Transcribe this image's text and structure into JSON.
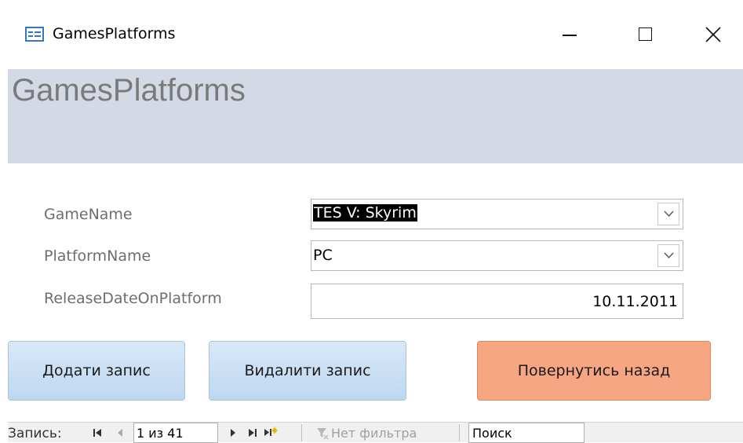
{
  "window": {
    "title": "GamesPlatforms"
  },
  "header": {
    "title": "GamesPlatforms"
  },
  "form": {
    "fields": [
      {
        "label": "GameName",
        "value": "TES V: Skyrim"
      },
      {
        "label": "PlatformName",
        "value": "PC"
      },
      {
        "label": "ReleaseDateOnPlatform",
        "value": "10.11.2011"
      }
    ]
  },
  "buttons": {
    "add": "Додати запис",
    "delete": "Видалити запис",
    "back": "Повернутись назад"
  },
  "navigation": {
    "record_label": "Запись:",
    "record_position": "1 из 41",
    "filter_label": "Нет фильтра",
    "search_placeholder": "Поиск"
  },
  "colors": {
    "header_band": "#d4dae5",
    "button_blue": "#c9def4",
    "button_orange": "#f6a683",
    "app_icon": "#2f78c8"
  },
  "icons": {
    "app": "form-icon",
    "minimize": "minimize-icon",
    "maximize": "maximize-icon",
    "close": "close-icon",
    "dropdown": "chevron-down-icon",
    "first": "first-record-icon",
    "prev": "previous-record-icon",
    "next": "next-record-icon",
    "last": "last-record-icon",
    "new": "new-record-icon",
    "filter": "filter-icon"
  }
}
